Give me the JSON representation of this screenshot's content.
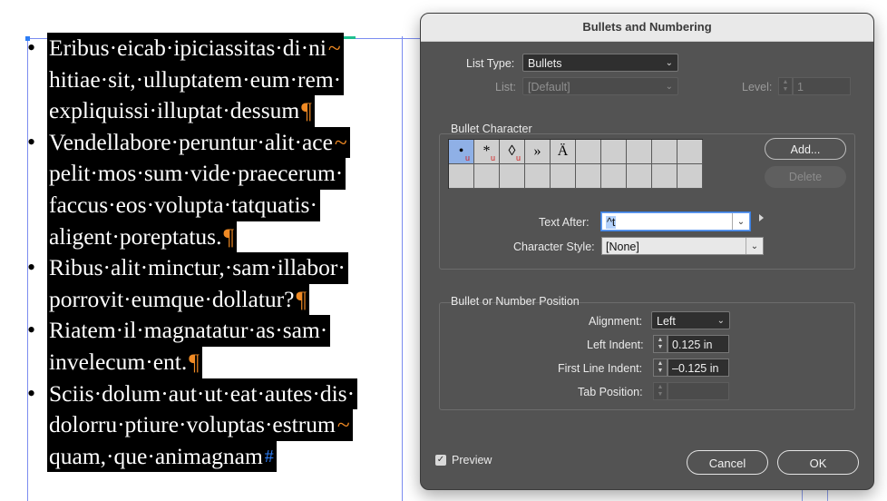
{
  "document": {
    "paragraphs": [
      {
        "lines": [
          "Eribus·eicab·ipiciassitas·di·ni",
          "hitiae·sit,·ulluptatem·eum·rem·",
          "expliquissi·illuptat·dessum"
        ],
        "line_end_marks": [
          "~",
          "",
          "¶"
        ]
      },
      {
        "lines": [
          "Vendellabore·peruntur·alit·ace",
          "pelit·mos·sum·vide·praecerum·",
          "faccus·eos·volupta·tatquatis·",
          "aligent·poreptatus."
        ],
        "line_end_marks": [
          "~",
          "",
          "",
          "¶"
        ]
      },
      {
        "lines": [
          "Ribus·alit·minctur,·sam·illabor·",
          "porrovit·eumque·dollatur?"
        ],
        "line_end_marks": [
          "",
          "¶"
        ]
      },
      {
        "lines": [
          "Riatem·il·magnatatur·as·sam·",
          "invelecum·ent."
        ],
        "line_end_marks": [
          "",
          "¶"
        ]
      },
      {
        "lines": [
          "Sciis·dolum·aut·ut·eat·autes·dis·",
          "dolorru·ptiure·voluptas·estrum",
          "quam,·que·animagnam"
        ],
        "line_end_marks": [
          "",
          "~",
          "#"
        ]
      }
    ],
    "bullet_symbol": "•"
  },
  "dialog": {
    "title": "Bullets and Numbering",
    "list_type_label": "List Type:",
    "list_type_value": "Bullets",
    "list_label": "List:",
    "list_value": "[Default]",
    "level_label": "Level:",
    "level_value": "1",
    "bullet_character": {
      "section_title": "Bullet Character",
      "glyphs": [
        {
          "char": "•",
          "sub": "u",
          "selected": true
        },
        {
          "char": "*",
          "sub": "u",
          "selected": false
        },
        {
          "char": "◊",
          "sub": "u",
          "selected": false
        },
        {
          "char": "»",
          "sub": "",
          "selected": false
        },
        {
          "char": "Ä",
          "sub": "",
          "selected": false
        }
      ],
      "empty_cells": 15,
      "add_label": "Add...",
      "delete_label": "Delete",
      "text_after_label": "Text After:",
      "text_after_value": "^t",
      "character_style_label": "Character Style:",
      "character_style_value": "[None]"
    },
    "position": {
      "section_title": "Bullet or Number Position",
      "alignment_label": "Alignment:",
      "alignment_value": "Left",
      "left_indent_label": "Left Indent:",
      "left_indent_value": "0.125 in",
      "first_line_indent_label": "First Line Indent:",
      "first_line_indent_value": "–0.125 in",
      "tab_position_label": "Tab Position:",
      "tab_position_value": ""
    },
    "preview_label": "Preview",
    "preview_checked": true,
    "cancel_label": "Cancel",
    "ok_label": "OK"
  }
}
